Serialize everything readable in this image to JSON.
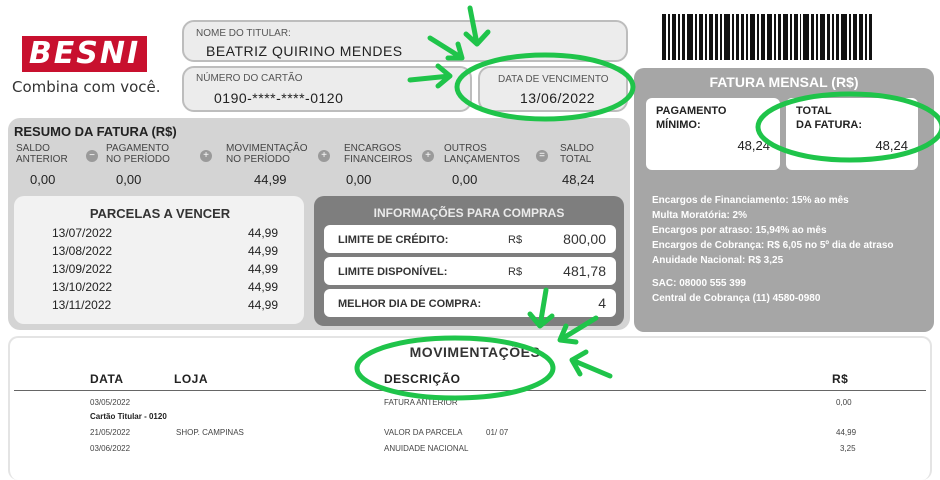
{
  "brand": {
    "name": "BESNI",
    "tagline": "Combina com você.",
    "color": "#c8102e"
  },
  "holder": {
    "label": "NOME DO TITULAR:",
    "value": "BEATRIZ QUIRINO MENDES"
  },
  "card": {
    "label": "NÚMERO DO CARTÃO",
    "value": "0190-****-****-0120"
  },
  "due": {
    "label": "DATA DE VENCIMENTO",
    "value": "13/06/2022"
  },
  "summary": {
    "title": "RESUMO DA FATURA (R$)",
    "items": [
      {
        "label1": "SALDO",
        "label2": "ANTERIOR",
        "value": "0,00"
      },
      {
        "label1": "PAGAMENTO",
        "label2": "NO PERÍODO",
        "value": "0,00"
      },
      {
        "label1": "MOVIMENTAÇÃO",
        "label2": "NO PERÍODO",
        "value": "44,99"
      },
      {
        "label1": "ENCARGOS",
        "label2": "FINANCEIROS",
        "value": "0,00"
      },
      {
        "label1": "OUTROS",
        "label2": "LANÇAMENTOS",
        "value": "0,00"
      },
      {
        "label1": "SALDO",
        "label2": "TOTAL",
        "value": "48,24"
      }
    ],
    "operators": [
      "−",
      "+",
      "+",
      "+",
      "="
    ]
  },
  "installments": {
    "title": "PARCELAS A VENCER",
    "rows": [
      {
        "date": "13/07/2022",
        "amount": "44,99"
      },
      {
        "date": "13/08/2022",
        "amount": "44,99"
      },
      {
        "date": "13/09/2022",
        "amount": "44,99"
      },
      {
        "date": "13/10/2022",
        "amount": "44,99"
      },
      {
        "date": "13/11/2022",
        "amount": "44,99"
      }
    ]
  },
  "purchase_info": {
    "title": "INFORMAÇÕES PARA COMPRAS",
    "rows": [
      {
        "label": "LIMITE DE CRÉDITO:",
        "currency": "R$",
        "value": "800,00"
      },
      {
        "label": "LIMITE DISPONÍVEL:",
        "currency": "R$",
        "value": "481,78"
      },
      {
        "label": "MELHOR DIA DE COMPRA:",
        "currency": "",
        "value": "4"
      }
    ]
  },
  "monthly": {
    "title": "FATURA MENSAL (R$)",
    "min_label1": "PAGAMENTO",
    "min_label2": "MÍNIMO:",
    "min_value": "48,24",
    "total_label1": "TOTAL",
    "total_label2": "DA FATURA:",
    "total_value": "48,24",
    "notes": [
      "Encargos de Financiamento: 15% ao mês",
      "Multa Moratória: 2%",
      "Encargos por atraso: 15,94% ao mês",
      "Encargos de Cobrança: R$ 6,05 no 5º dia de atraso",
      "Anuidade Nacional: R$ 3,25"
    ],
    "contacts": [
      "SAC: 08000 555 399",
      "Central de Cobrança (11) 4580-0980"
    ]
  },
  "transactions": {
    "title": "MOVIMENTAÇÕES",
    "headers": {
      "date": "DATA",
      "store": "LOJA",
      "description": "DESCRIÇÃO",
      "amount": "R$"
    },
    "rows": [
      {
        "date": "03/05/2022",
        "store": "",
        "description": "FATURA ANTERIOR",
        "installment": "",
        "amount": "0,00"
      },
      {
        "date": "Cartão Titular - 0120",
        "store": "",
        "description": "",
        "installment": "",
        "amount": ""
      },
      {
        "date": "21/05/2022",
        "store": "SHOP. CAMPINAS",
        "description": "VALOR DA PARCELA",
        "installment": "01/ 07",
        "amount": "44,99"
      },
      {
        "date": "03/06/2022",
        "store": "",
        "description": "ANUIDADE NACIONAL",
        "installment": "",
        "amount": "3,25"
      }
    ]
  },
  "annotation_color": "#1fc44a"
}
